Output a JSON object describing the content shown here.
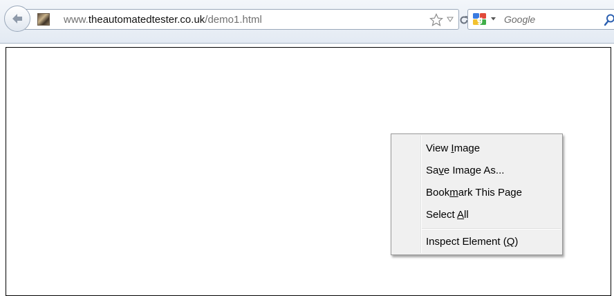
{
  "toolbar": {
    "url_prefix": "www.",
    "url_domain": "theautomatedtester.co.uk",
    "url_path": "/demo1.html",
    "search_placeholder": "Google"
  },
  "context_menu": {
    "items": [
      {
        "before": "View ",
        "mnemonic": "I",
        "after": "mage"
      },
      {
        "before": "Sa",
        "mnemonic": "v",
        "after": "e Image As..."
      },
      {
        "before": "Book",
        "mnemonic": "m",
        "after": "ark This Page"
      },
      {
        "before": "Select ",
        "mnemonic": "A",
        "after": "ll"
      },
      {
        "before": "Inspect Element (",
        "mnemonic": "Q",
        "after": ")"
      }
    ]
  },
  "colors": {
    "toolbar_bg": "#e3eaf3",
    "menu_bg": "#f0f0f0",
    "url_domain": "#111111",
    "url_rest": "#707070"
  },
  "icons": [
    "back-arrow-icon",
    "site-favicon",
    "star-icon",
    "dropdown-arrow-icon",
    "reload-icon",
    "google-icon",
    "search-icon"
  ]
}
